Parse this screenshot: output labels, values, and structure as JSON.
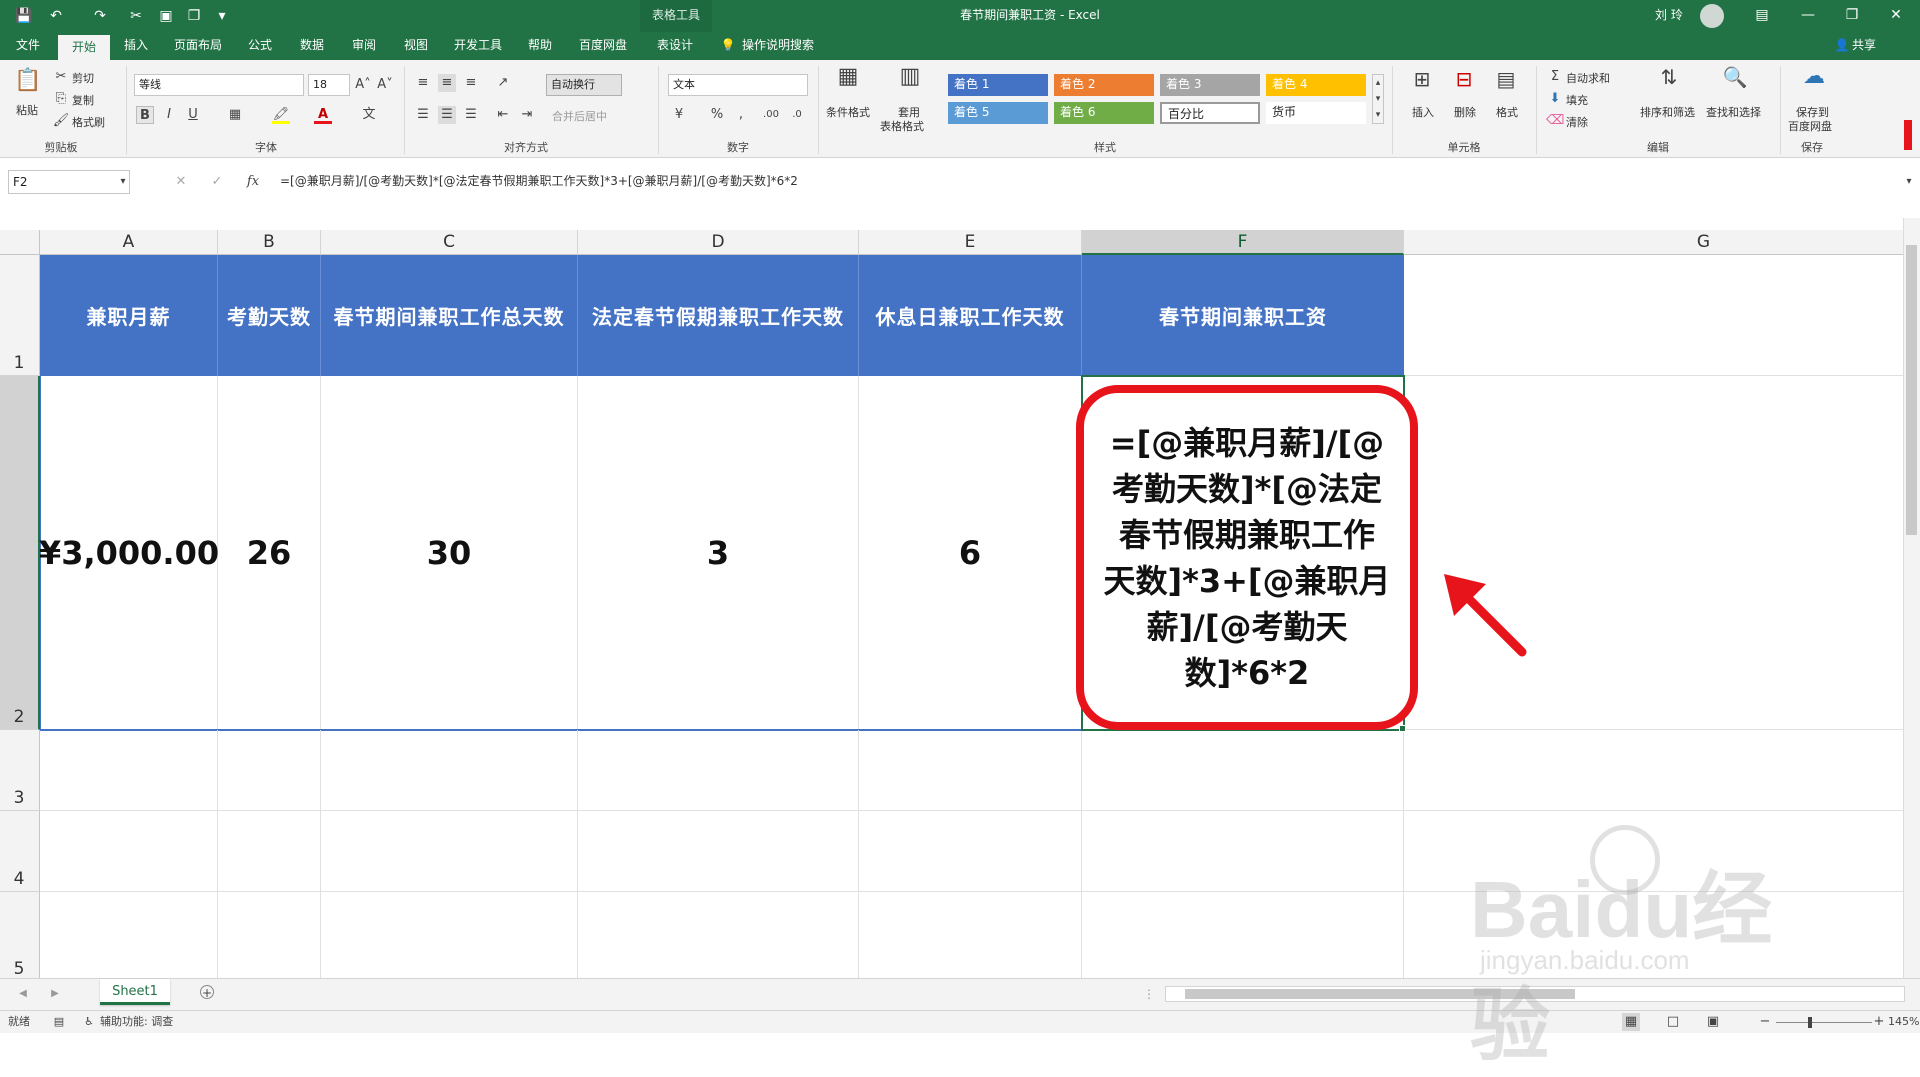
{
  "window": {
    "title": "春节期间兼职工资  -  Excel",
    "context_tab_group": "表格工具",
    "user": "刘 玲",
    "share": "共享"
  },
  "ribbon_tabs": [
    "文件",
    "开始",
    "插入",
    "页面布局",
    "公式",
    "数据",
    "审阅",
    "视图",
    "开发工具",
    "帮助",
    "百度网盘",
    "表设计"
  ],
  "active_tab": "开始",
  "tell_me": "操作说明搜索",
  "clipboard": {
    "paste": "粘贴",
    "cut": "剪切",
    "copy": "复制",
    "format_painter": "格式刷",
    "label": "剪贴板"
  },
  "font": {
    "name": "等线",
    "size": "18",
    "bold": "B",
    "italic": "I",
    "underline": "U",
    "label": "字体"
  },
  "alignment": {
    "wrap_text": "自动换行",
    "merge_center": "合并后居中",
    "label": "对齐方式"
  },
  "number": {
    "format": "文本",
    "label": "数字"
  },
  "styles": {
    "conditional_formatting": "条件格式",
    "format_as_table_line1": "套用",
    "format_as_table_line2": "表格格式",
    "tiles": [
      {
        "text": "着色 1",
        "color": "#4472c4"
      },
      {
        "text": "着色 2",
        "color": "#ed7d31"
      },
      {
        "text": "着色 3",
        "color": "#a5a5a5"
      },
      {
        "text": "着色 4",
        "color": "#ffc000"
      },
      {
        "text": "着色 5",
        "color": "#5b9bd5"
      },
      {
        "text": "着色 6",
        "color": "#70ad47"
      },
      {
        "text": "百分比",
        "color": "#ffffff"
      },
      {
        "text": "货币",
        "color": "#ffffff"
      }
    ],
    "label": "样式"
  },
  "cells_group": {
    "insert": "插入",
    "delete": "删除",
    "format": "格式",
    "label": "单元格"
  },
  "editing": {
    "autosum": "自动求和",
    "fill": "填充",
    "clear": "清除",
    "sort_filter": "排序和筛选",
    "find_select": "查找和选择",
    "label": "编辑"
  },
  "save_group": {
    "save_line1": "保存到",
    "save_line2": "百度网盘",
    "label": "保存"
  },
  "formula_bar": {
    "name_box": "F2",
    "fx": "fx",
    "formula": "=[@兼职月薪]/[@考勤天数]*[@法定春节假期兼职工作天数]*3+[@兼职月薪]/[@考勤天数]*6*2"
  },
  "columns": [
    "A",
    "B",
    "C",
    "D",
    "E",
    "F",
    "G"
  ],
  "selected_column": "F",
  "rows": [
    "1",
    "2",
    "3",
    "4",
    "5"
  ],
  "selected_row": "2",
  "table": {
    "headers": [
      "兼职月薪",
      "考勤天数",
      "春节期间兼职工作总天数",
      "法定春节假期兼职工作天数",
      "休息日兼职工作天数",
      "春节期间兼职工资"
    ],
    "row2": [
      "¥3,000.00",
      "26",
      "30",
      "3",
      "6"
    ],
    "f2_display_lines": [
      "=[@兼职月薪]/[@",
      "考勤天数]*[@法定",
      "春节假期兼职工作",
      "天数]*3+[@兼职月",
      "薪]/[@考勤天",
      "数]*6*2"
    ],
    "header_color": "#4472c4"
  },
  "sheet_tabs": [
    "Sheet1"
  ],
  "status": {
    "mode": "就绪",
    "accessibility": "辅助功能: 调查",
    "zoom": "145%"
  },
  "watermark": {
    "big": "Baidu经验",
    "small": "jingyan.baidu.com"
  },
  "colors": {
    "brand_green": "#217346",
    "highlight_red": "#e8141b",
    "arrow_red": "#e8141b"
  }
}
